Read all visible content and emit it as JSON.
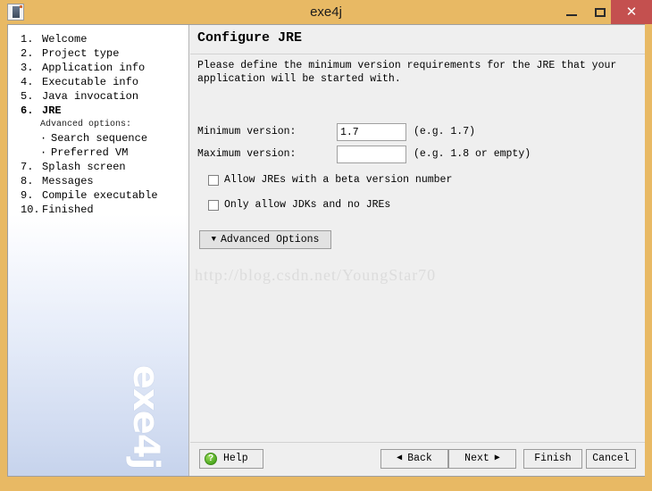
{
  "window": {
    "title": "exe4j",
    "icon": "app-icon",
    "controls": {
      "minimize": "–",
      "maximize": "❑",
      "close": "✕"
    }
  },
  "sidebar": {
    "items": [
      {
        "num": "1.",
        "label": "Welcome",
        "active": false
      },
      {
        "num": "2.",
        "label": "Project type",
        "active": false
      },
      {
        "num": "3.",
        "label": "Application info",
        "active": false
      },
      {
        "num": "4.",
        "label": "Executable info",
        "active": false
      },
      {
        "num": "5.",
        "label": "Java invocation",
        "active": false
      },
      {
        "num": "6.",
        "label": "JRE",
        "active": true
      }
    ],
    "advanced_title": "Advanced options:",
    "advanced_items": [
      {
        "bullet": "·",
        "label": "Search sequence"
      },
      {
        "bullet": "·",
        "label": "Preferred VM"
      }
    ],
    "items_after": [
      {
        "num": "7.",
        "label": "Splash screen",
        "active": false
      },
      {
        "num": "8.",
        "label": "Messages",
        "active": false
      },
      {
        "num": "9.",
        "label": "Compile executable",
        "active": false
      },
      {
        "num": "10.",
        "label": "Finished",
        "active": false
      }
    ],
    "logo": "exe4j"
  },
  "main": {
    "title": "Configure JRE",
    "description": "Please define the minimum version requirements for the JRE that your application will be started with.",
    "fields": [
      {
        "label": "Minimum version:",
        "value": "1.7",
        "placeholder": "",
        "hint": "(e.g. 1.7)"
      },
      {
        "label": "Maximum version:",
        "value": "",
        "placeholder": "",
        "hint": "(e.g. 1.8 or empty)"
      }
    ],
    "checkboxes": [
      {
        "label": "Allow JREs with a beta version number",
        "checked": false
      },
      {
        "label": "Only allow JDKs and no JREs",
        "checked": false
      }
    ],
    "advanced_button": {
      "label": "Advanced Options",
      "icon": "chevron-down-icon",
      "glyph": "▼"
    },
    "watermark": "http://blog.csdn.net/YoungStar70"
  },
  "footer": {
    "help": "Help",
    "back": "Back",
    "next": "Next",
    "finish": "Finish",
    "cancel": "Cancel",
    "back_arrow": "◀",
    "next_arrow": "▶",
    "help_glyph": "?"
  },
  "colors": {
    "window_frame": "#e8b964",
    "close_button": "#c4504f",
    "help_icon": "#4faa21",
    "panel": "#efefef"
  }
}
